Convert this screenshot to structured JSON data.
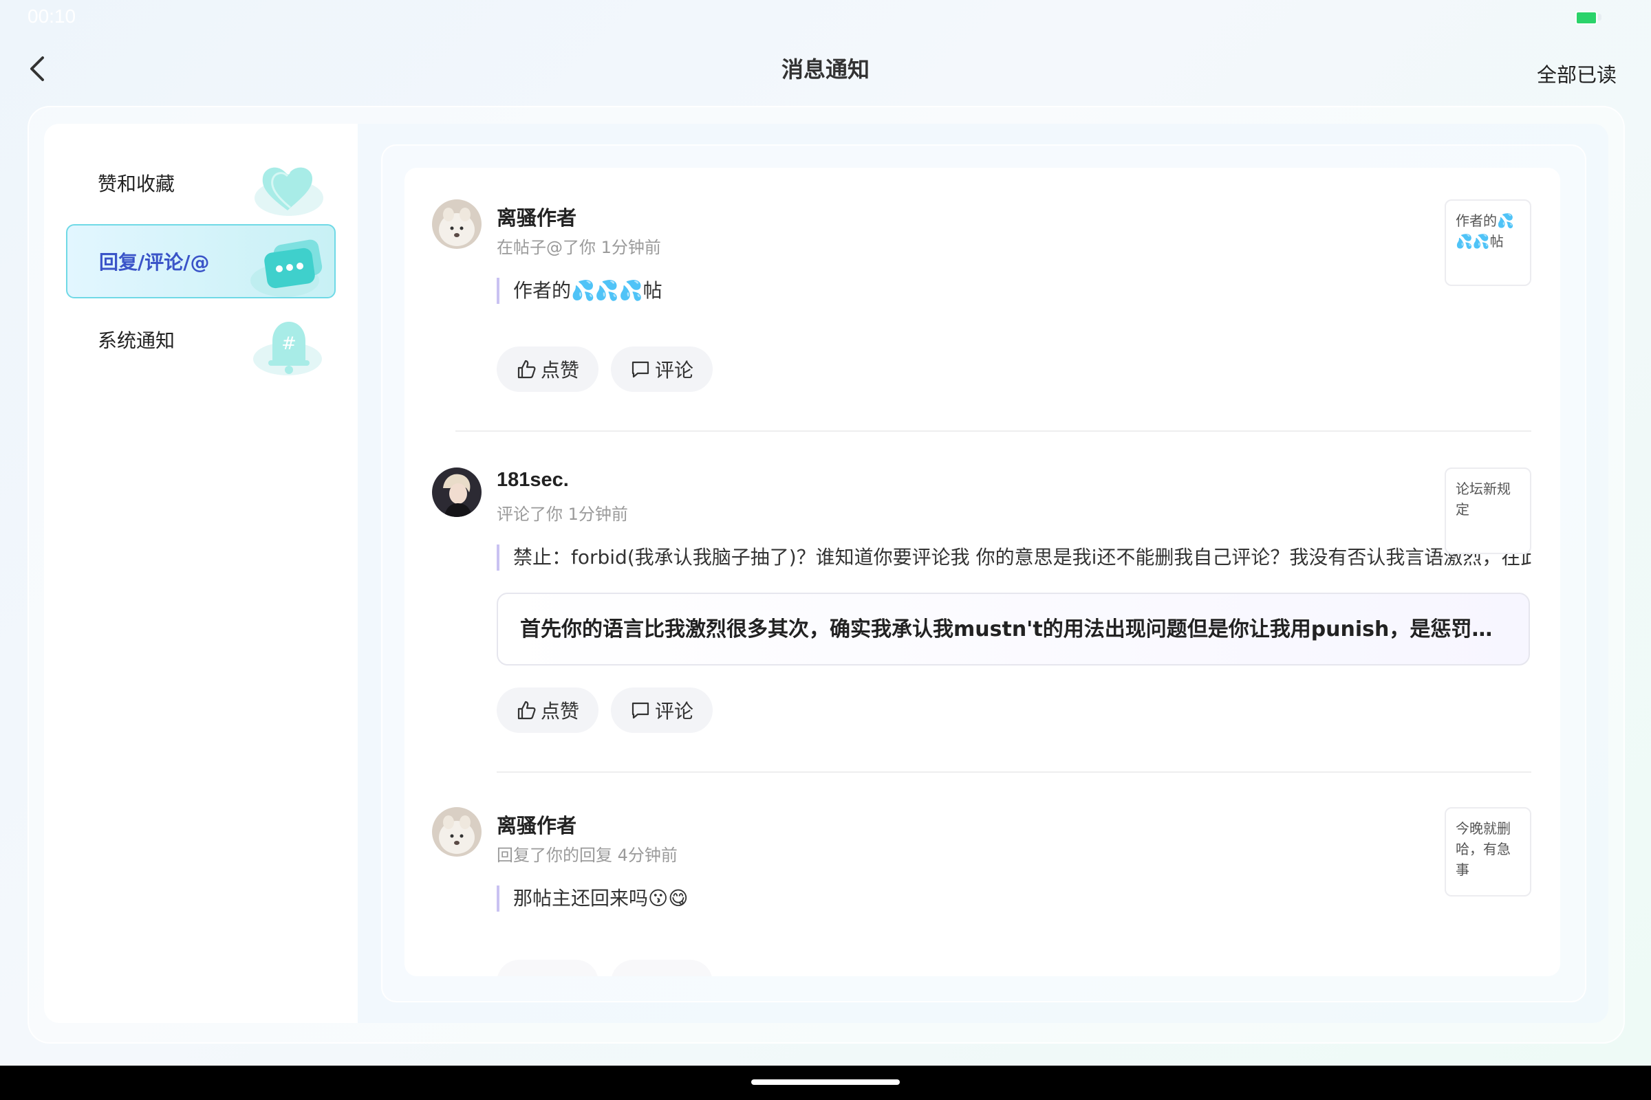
{
  "status": {
    "time": "00:10"
  },
  "header": {
    "title": "消息通知",
    "mark_all_read": "全部已读"
  },
  "sidebar": {
    "items": [
      {
        "label": "赞和收藏",
        "icon": "heart-icon",
        "active": false
      },
      {
        "label": "回复/评论/@",
        "icon": "chat-bubble-icon",
        "active": true
      },
      {
        "label": "系统通知",
        "icon": "bell-icon",
        "active": false
      }
    ]
  },
  "notifications": [
    {
      "user": "离骚作者",
      "meta": "在帖子@了你 1分钟前",
      "quote": "作者的💦💦💦帖",
      "thumb": "作者的💦💦💦帖",
      "like_label": "点赞",
      "comment_label": "评论"
    },
    {
      "user": "181sec.",
      "meta": "评论了你 1分钟前",
      "quote": "禁止：forbid(我承认我脑子抽了)？谁知道你要评论我 你的意思是我i还不能删我自己评论？我没有否认我言语激烈，在此致歉",
      "reply": "首先你的语言比我激烈很多其次，确实我承认我mustn't的用法出现问题但是你让我用punish，是惩罚而不是禁止",
      "thumb": "论坛新规定",
      "like_label": "点赞",
      "comment_label": "评论"
    },
    {
      "user": "离骚作者",
      "meta": "回复了你的回复 4分钟前",
      "quote": "那帖主还回来吗😗😋",
      "thumb": "今晚就删哈，有急事",
      "like_label": "点赞",
      "comment_label": "评论"
    }
  ],
  "colors": {
    "accent": "#3a54c8",
    "active_border": "#6fd9e6",
    "quote_bar": "#c9c2f2",
    "drop": "#3aa8e8"
  }
}
